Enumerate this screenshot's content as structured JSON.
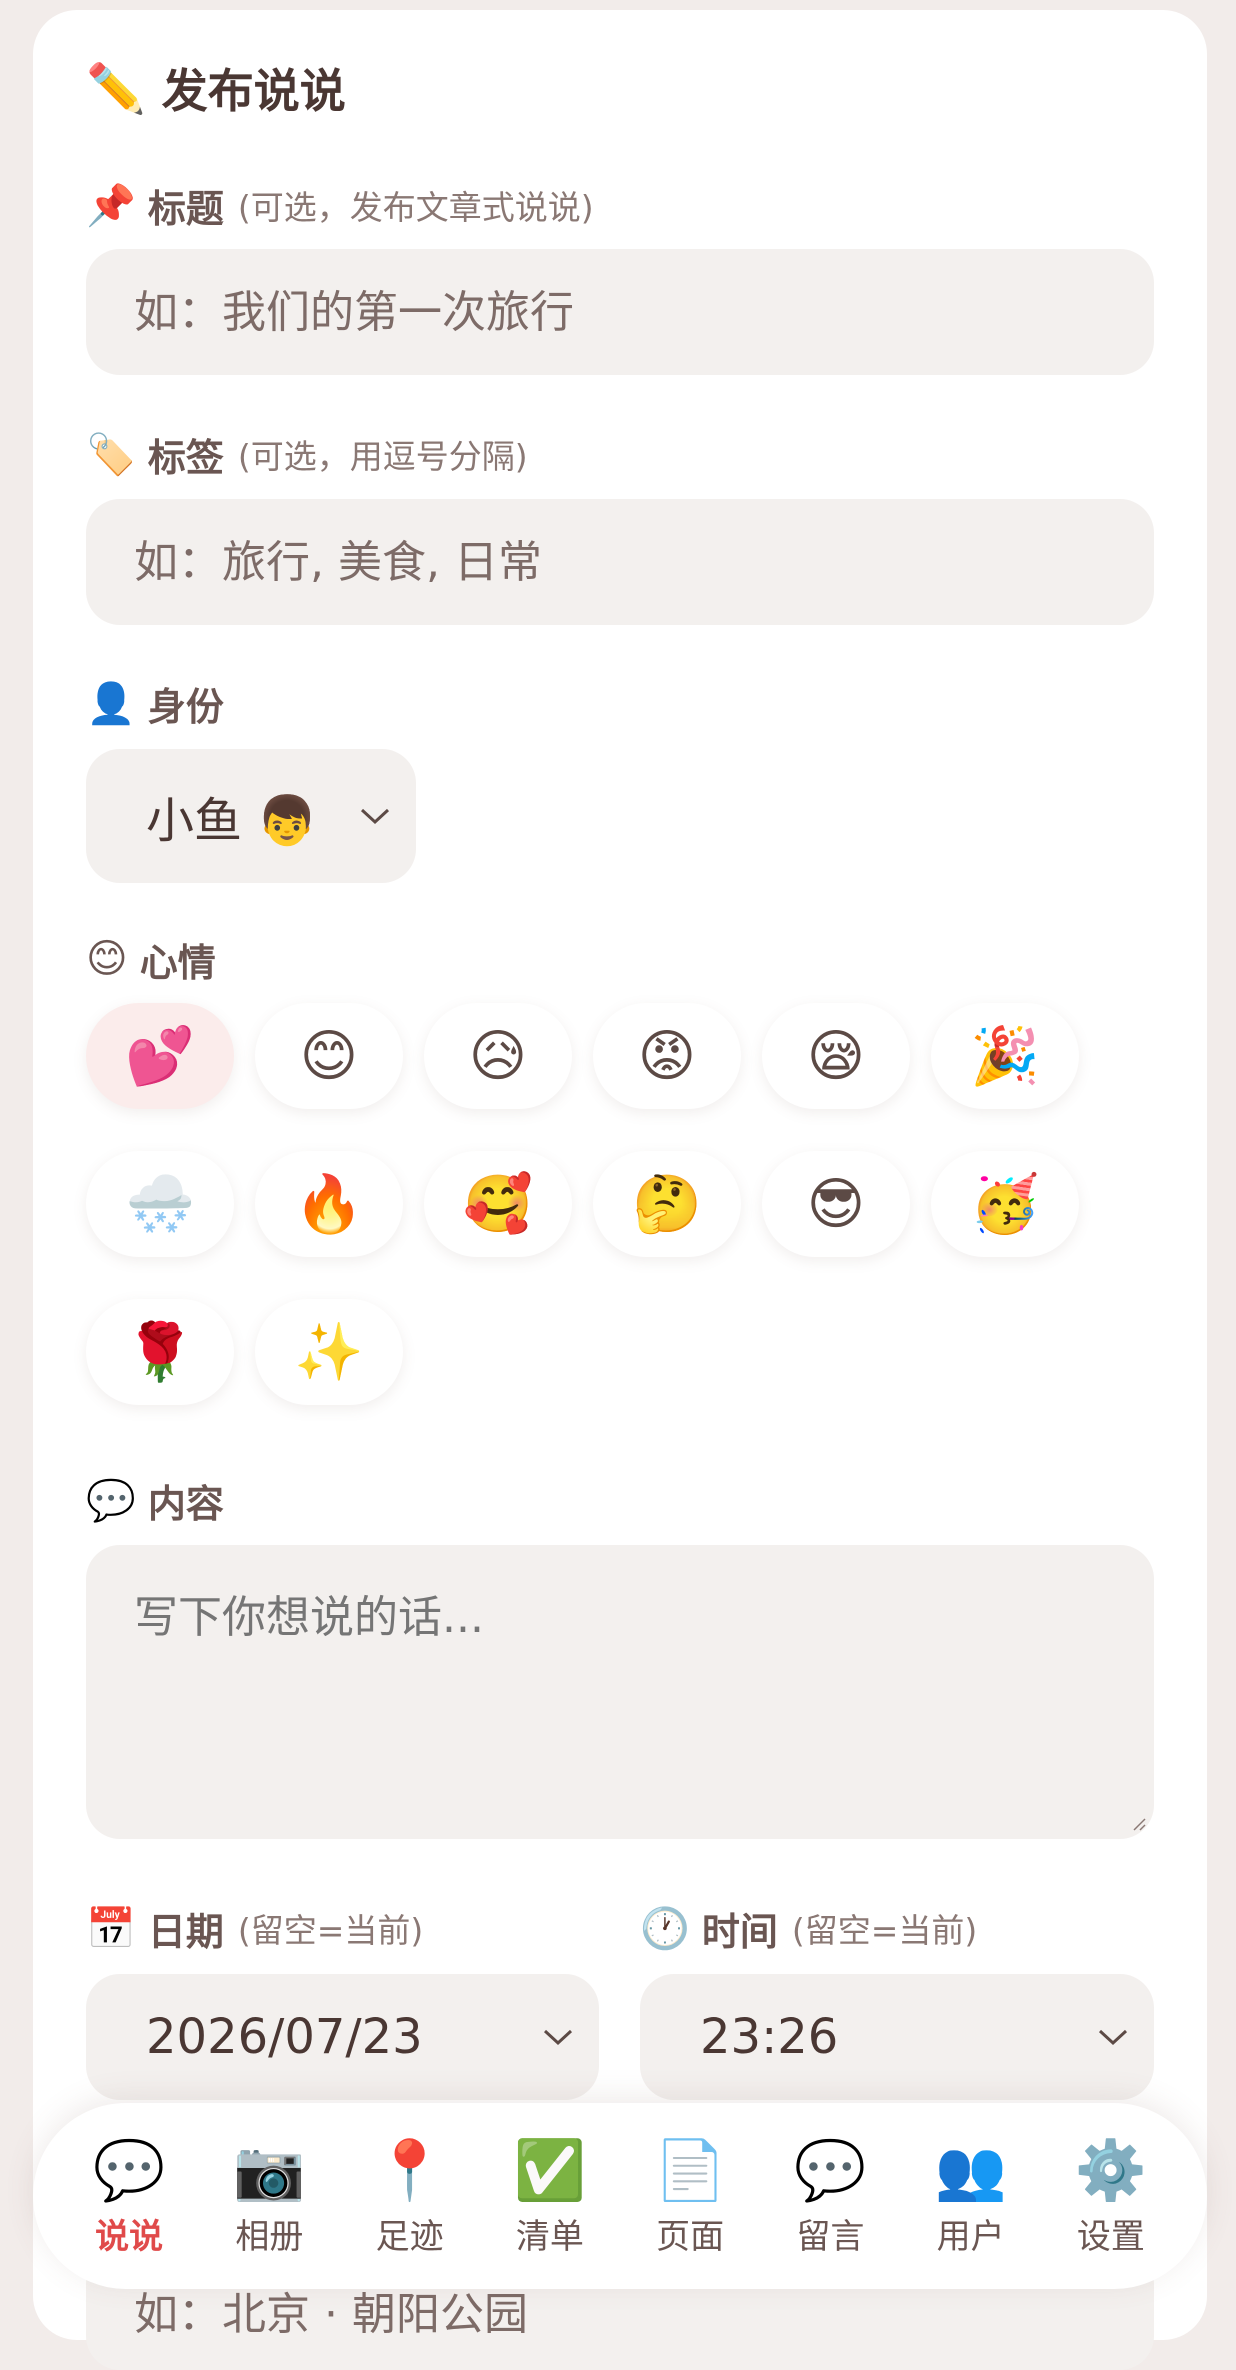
{
  "header": {
    "icon": "✏️",
    "icon_name": "pencil-icon",
    "title": "发布说说"
  },
  "title_field": {
    "icon": "📌",
    "icon_name": "pushpin-icon",
    "label": "标题",
    "hint": "(可选，发布文章式说说)",
    "placeholder": "如：我们的第一次旅行"
  },
  "tags_field": {
    "icon": "🏷️",
    "icon_name": "tag-icon",
    "label": "标签",
    "hint": "(可选，用逗号分隔)",
    "placeholder": "如：旅行, 美食, 日常"
  },
  "identity": {
    "icon": "👤",
    "icon_name": "user-silhouette-icon",
    "label": "身份",
    "selected": "小鱼 👦"
  },
  "mood": {
    "icon": "😊",
    "icon_name": "smile-icon",
    "label": "心情",
    "options": [
      "💕",
      "😊",
      "😥",
      "😡",
      "😪",
      "🎉",
      "🌨️",
      "🔥",
      "🥰",
      "🤔",
      "😎",
      "🥳",
      "🌹",
      "✨"
    ],
    "selected_index": 0
  },
  "content": {
    "icon": "💬",
    "icon_name": "speech-bubble-icon",
    "label": "内容",
    "placeholder": "写下你想说的话..."
  },
  "date": {
    "icon": "📅",
    "icon_name": "calendar-icon",
    "label": "日期",
    "hint": "(留空=当前)",
    "value": "2026/07/23"
  },
  "time": {
    "icon": "🕐",
    "icon_name": "clock-icon",
    "label": "时间",
    "hint": "(留空=当前)",
    "value": "23:26"
  },
  "location": {
    "placeholder": "如：北京 · 朝阳公园"
  },
  "nav": {
    "items": [
      {
        "icon": "💬",
        "label": "说说",
        "active": true
      },
      {
        "icon": "📷",
        "label": "相册"
      },
      {
        "icon": "📍",
        "label": "足迹"
      },
      {
        "icon": "✅",
        "label": "清单"
      },
      {
        "icon": "📄",
        "label": "页面"
      },
      {
        "icon": "💬",
        "label": "留言"
      },
      {
        "icon": "👥",
        "label": "用户"
      },
      {
        "icon": "⚙️",
        "label": "设置"
      }
    ],
    "active_color": "#e04a4a"
  }
}
